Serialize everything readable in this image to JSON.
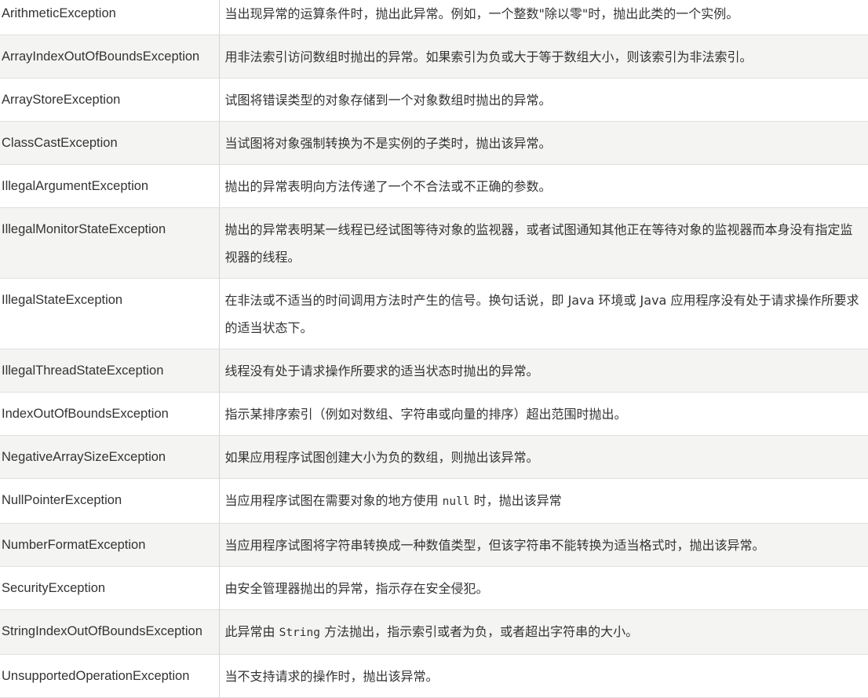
{
  "table": {
    "rows": [
      {
        "name": "ArithmeticException",
        "desc": "当出现异常的运算条件时，抛出此异常。例如，一个整数\"除以零\"时，抛出此类的一个实例。"
      },
      {
        "name": "ArrayIndexOutOfBoundsException",
        "desc": "用非法索引访问数组时抛出的异常。如果索引为负或大于等于数组大小，则该索引为非法索引。"
      },
      {
        "name": "ArrayStoreException",
        "desc": "试图将错误类型的对象存储到一个对象数组时抛出的异常。"
      },
      {
        "name": "ClassCastException",
        "desc": "当试图将对象强制转换为不是实例的子类时，抛出该异常。"
      },
      {
        "name": "IllegalArgumentException",
        "desc": "抛出的异常表明向方法传递了一个不合法或不正确的参数。"
      },
      {
        "name": "IllegalMonitorStateException",
        "desc": "抛出的异常表明某一线程已经试图等待对象的监视器，或者试图通知其他正在等待对象的监视器而本身没有指定监视器的线程。"
      },
      {
        "name": "IllegalStateException",
        "desc": "在非法或不适当的时间调用方法时产生的信号。换句话说，即 Java 环境或 Java 应用程序没有处于请求操作所要求的适当状态下。"
      },
      {
        "name": "IllegalThreadStateException",
        "desc": "线程没有处于请求操作所要求的适当状态时抛出的异常。"
      },
      {
        "name": "IndexOutOfBoundsException",
        "desc": "指示某排序索引（例如对数组、字符串或向量的排序）超出范围时抛出。"
      },
      {
        "name": "NegativeArraySizeException",
        "desc": "如果应用程序试图创建大小为负的数组，则抛出该异常。"
      },
      {
        "name": "NullPointerException",
        "desc_pre": "当应用程序试图在需要对象的地方使用 ",
        "desc_code": "null",
        "desc_post": " 时，抛出该异常"
      },
      {
        "name": "NumberFormatException",
        "desc": "当应用程序试图将字符串转换成一种数值类型，但该字符串不能转换为适当格式时，抛出该异常。"
      },
      {
        "name": "SecurityException",
        "desc": "由安全管理器抛出的异常，指示存在安全侵犯。"
      },
      {
        "name": "StringIndexOutOfBoundsException",
        "desc_pre": "此异常由 ",
        "desc_code": "String",
        "desc_post": " 方法抛出，指示索引或者为负，或者超出字符串的大小。"
      },
      {
        "name": "UnsupportedOperationException",
        "desc": "当不支持请求的操作时，抛出该异常。"
      }
    ]
  }
}
